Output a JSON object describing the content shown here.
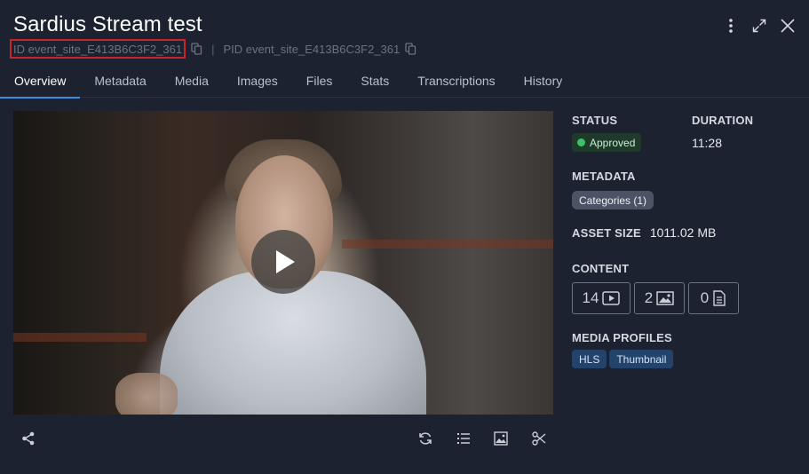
{
  "header": {
    "title": "Sardius Stream test",
    "id_text": "ID event_site_E413B6C3F2_361",
    "separator": "|",
    "pid_text": "PID event_site_E413B6C3F2_361"
  },
  "tabs": [
    {
      "label": "Overview"
    },
    {
      "label": "Metadata"
    },
    {
      "label": "Media"
    },
    {
      "label": "Images"
    },
    {
      "label": "Files"
    },
    {
      "label": "Stats"
    },
    {
      "label": "Transcriptions"
    },
    {
      "label": "History"
    }
  ],
  "active_tab": "Overview",
  "sidebar": {
    "status_label": "STATUS",
    "status_value": "Approved",
    "duration_label": "DURATION",
    "duration_value": "11:28",
    "metadata_label": "METADATA",
    "metadata_badge": "Categories (1)",
    "asset_size_label": "ASSET SIZE",
    "asset_size_value": "1011.02 MB",
    "content_label": "CONTENT",
    "content_counts": {
      "videos": "14",
      "images": "2",
      "files": "0"
    },
    "media_profiles_label": "MEDIA PROFILES",
    "media_profiles": [
      "HLS",
      "Thumbnail"
    ]
  },
  "colors": {
    "background": "#1c2230",
    "accent": "#3c8de0",
    "status_green": "#3fbf6a",
    "highlight_box": "#c9232b"
  },
  "icons": {
    "window": [
      "more-vertical-icon",
      "expand-icon",
      "close-icon"
    ],
    "toolbar": [
      "share-icon",
      "refresh-icon",
      "list-icon",
      "image-icon",
      "scissors-icon"
    ]
  }
}
